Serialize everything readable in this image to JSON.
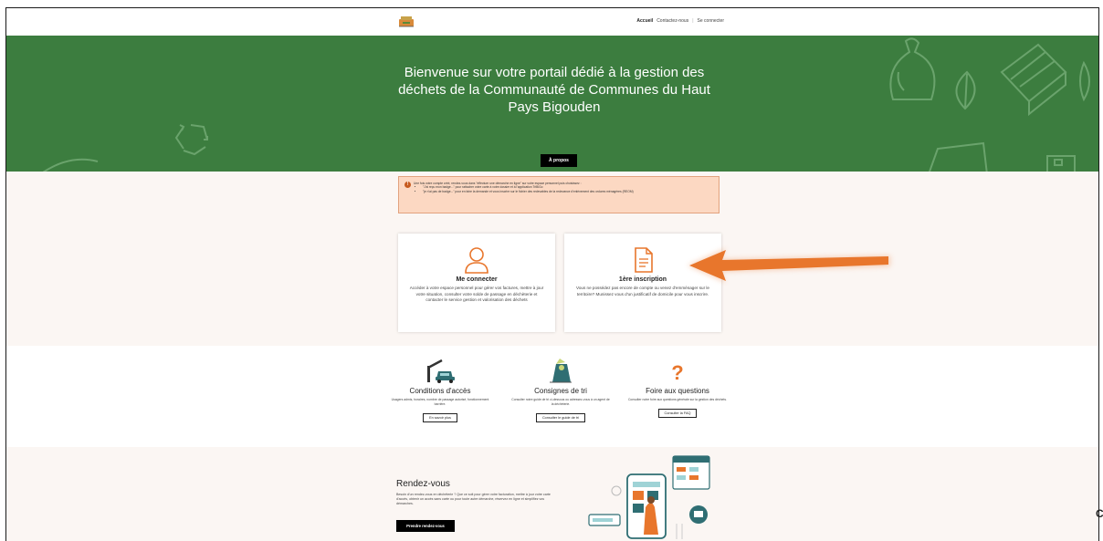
{
  "nav": {
    "items": [
      "Accueil",
      "Contactez-nous",
      "Se connecter"
    ],
    "active": "Accueil"
  },
  "hero": {
    "title": "Bienvenue sur votre portail dédié à la gestion des déchets de la Communauté de Communes du Haut Pays Bigouden",
    "button": "À propos"
  },
  "alert": {
    "intro": "Une fois votre compte créé, rendez-vous dans \"effectuer une démarche en ligne\" sur votre espace personnel puis choisissez :",
    "items": [
      "\"J'ai reçu mon badge...\" pour rattacher votre carte à votre dossier et à l'application TriBiGo",
      "\"je n'ai pas de badge...\" pour en faire la demande et vous inscrire sur le fichier des redevables de la redevance d'enlèvement des ordures ménagères (REOM)"
    ]
  },
  "cards": [
    {
      "icon": "user-icon",
      "title": "Me connecter",
      "description": "Accéder à votre espace personnel pour gérer vos factures, mettre à jour votre situation, consulter votre solde de passage en déchèterie et contacter le service gestion et valorisation des déchets"
    },
    {
      "icon": "document-icon",
      "title": "1ère inscription",
      "description": "Vous ne possédez pas encore de compte ou venez d'emménager sur le territoire? Munissez vous d'un justificatif de domicile pour vous inscrire."
    }
  ],
  "features": [
    {
      "icon": "barrier-car-icon",
      "title": "Conditions d'accès",
      "description": "Usagers admis, horaires, nombre de passage autorisé, fonctionnement barrière.",
      "button": "En savoir plus"
    },
    {
      "icon": "sorting-bin-icon",
      "title": "Consignes de tri",
      "description": "Consulter notre guide de tri ci-dessous ou adressez-vous à un agent de la déchèterie.",
      "button": "Consulter le guide de tri"
    },
    {
      "icon": "question-mark-icon",
      "title": "Foire aux questions",
      "description": "Consulter notre foire aux questions générale sur la gestion des déchets.",
      "button": "Consulter la FAQ"
    }
  ],
  "rdv": {
    "title": "Rendez-vous",
    "description": "Besoin d'un rendez-vous en déchèterie ? Que ce soit pour gérer votre facturation, mettre à jour votre carte d'accès, obtenir un accès sans carte ou pour toute autre démarche, réservez en ligne et simplifiez vos démarches.",
    "button": "Prendre rendez-vous"
  },
  "colors": {
    "hero_green": "#3c7d3f",
    "accent_orange": "#e8762c",
    "alert_bg": "#fcd8c2",
    "page_bg": "#fbf6f3"
  }
}
